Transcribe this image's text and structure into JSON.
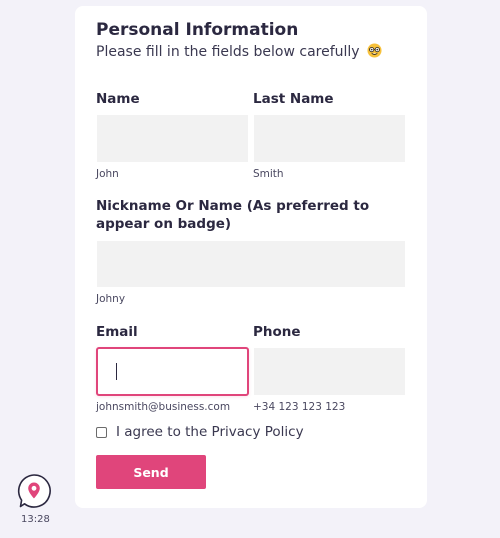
{
  "form": {
    "title": "Personal Information",
    "subtitle": "Please fill in the fields below carefully",
    "subtitle_icon": "nerd-face-emoji-icon",
    "fields": {
      "name": {
        "label": "Name",
        "value": "",
        "hint": "John"
      },
      "last_name": {
        "label": "Last Name",
        "value": "",
        "hint": "Smith"
      },
      "nickname": {
        "label": "Nickname Or Name (As preferred to appear on badge)",
        "value": "",
        "hint": "Johny"
      },
      "email": {
        "label": "Email",
        "value": "",
        "hint": "johnsmith@business.com",
        "focused": true
      },
      "phone": {
        "label": "Phone",
        "value": "",
        "hint": "+34 123 123 123"
      }
    },
    "agree": {
      "label": "I agree to the Privacy Policy",
      "checked": false
    },
    "send_label": "Send"
  },
  "chat_widget": {
    "icon": "chat-bubble-icon",
    "time": "13:28"
  },
  "colors": {
    "background": "#f3f2f9",
    "card": "#ffffff",
    "accent": "#e0457b",
    "input_fill": "#f2f2f2",
    "text": "#2b2840"
  }
}
